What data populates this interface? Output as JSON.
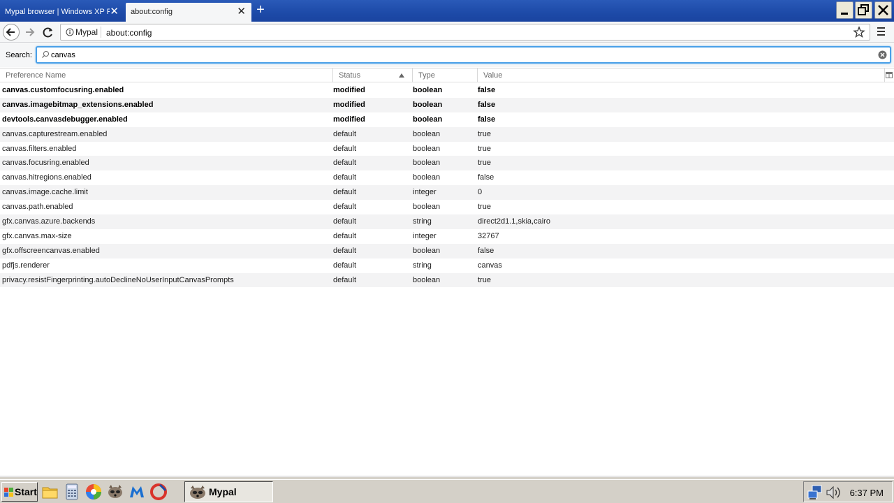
{
  "tabs": [
    {
      "label": "Mypal browser | Windows XP Fo",
      "active": false
    },
    {
      "label": "about:config",
      "active": true
    }
  ],
  "nav": {
    "identity_label": "Mypal",
    "url": "about:config"
  },
  "search": {
    "label": "Search:",
    "value": "canvas"
  },
  "columns": {
    "name": "Preference Name",
    "status": "Status",
    "type": "Type",
    "value": "Value"
  },
  "rows": [
    {
      "name": "canvas.customfocusring.enabled",
      "status": "modified",
      "type": "boolean",
      "value": "false"
    },
    {
      "name": "canvas.imagebitmap_extensions.enabled",
      "status": "modified",
      "type": "boolean",
      "value": "false"
    },
    {
      "name": "devtools.canvasdebugger.enabled",
      "status": "modified",
      "type": "boolean",
      "value": "false"
    },
    {
      "name": "canvas.capturestream.enabled",
      "status": "default",
      "type": "boolean",
      "value": "true"
    },
    {
      "name": "canvas.filters.enabled",
      "status": "default",
      "type": "boolean",
      "value": "true"
    },
    {
      "name": "canvas.focusring.enabled",
      "status": "default",
      "type": "boolean",
      "value": "true"
    },
    {
      "name": "canvas.hitregions.enabled",
      "status": "default",
      "type": "boolean",
      "value": "false"
    },
    {
      "name": "canvas.image.cache.limit",
      "status": "default",
      "type": "integer",
      "value": "0"
    },
    {
      "name": "canvas.path.enabled",
      "status": "default",
      "type": "boolean",
      "value": "true"
    },
    {
      "name": "gfx.canvas.azure.backends",
      "status": "default",
      "type": "string",
      "value": "direct2d1.1,skia,cairo"
    },
    {
      "name": "gfx.canvas.max-size",
      "status": "default",
      "type": "integer",
      "value": "32767"
    },
    {
      "name": "gfx.offscreencanvas.enabled",
      "status": "default",
      "type": "boolean",
      "value": "false"
    },
    {
      "name": "pdfjs.renderer",
      "status": "default",
      "type": "string",
      "value": "canvas"
    },
    {
      "name": "privacy.resistFingerprinting.autoDeclineNoUserInputCanvasPrompts",
      "status": "default",
      "type": "boolean",
      "value": "true"
    }
  ],
  "taskbar": {
    "start_label": "Start",
    "task_label": "Mypal",
    "clock": "6:37 PM"
  },
  "icons": {
    "back": "back-arrow-icon",
    "forward": "forward-arrow-icon",
    "reload": "reload-icon",
    "info": "info-icon",
    "bookmark": "star-icon",
    "menu": "hamburger-menu-icon",
    "search": "search-icon",
    "clear": "clear-icon",
    "sort": "sort-ascending-icon",
    "column_picker": "column-picker-icon"
  },
  "colors": {
    "titlebar": "#1d4aa8",
    "search_focus": "#4aa0e8",
    "row_alt": "#f3f3f4"
  }
}
